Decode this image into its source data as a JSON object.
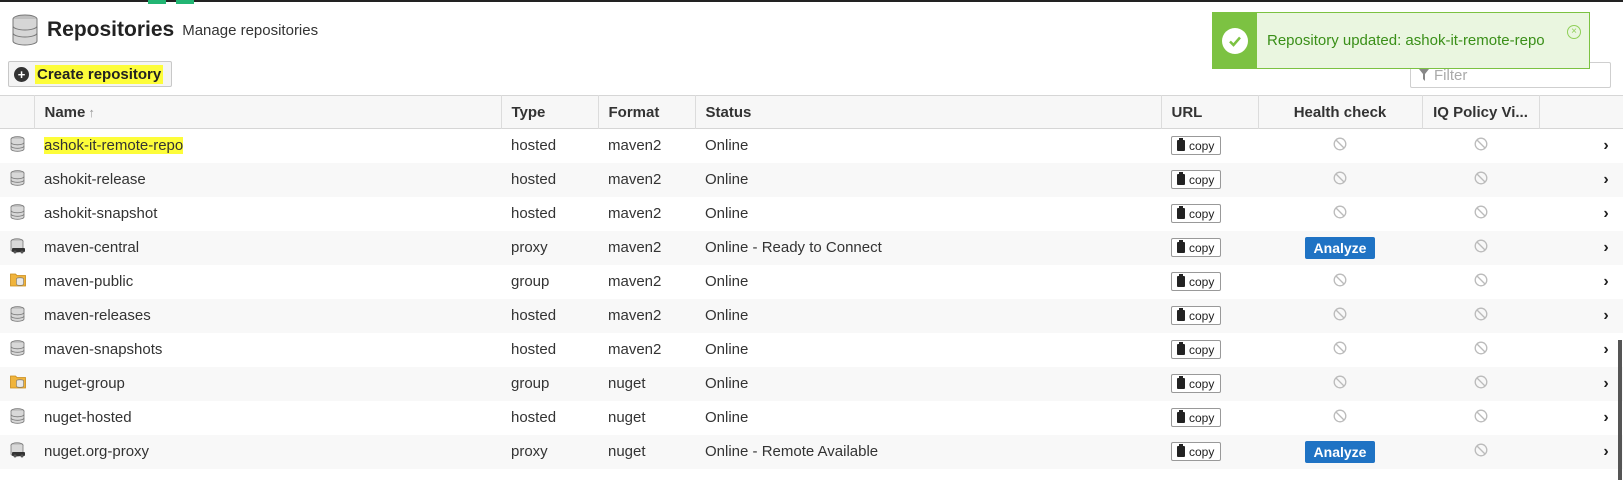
{
  "header": {
    "title": "Repositories",
    "subtitle": "Manage repositories"
  },
  "toolbar": {
    "create_label": "Create repository",
    "filter_placeholder": "Filter"
  },
  "toast": {
    "message": "Repository updated: ashok-it-remote-repo"
  },
  "table": {
    "columns": {
      "name": "Name",
      "sort_arrow": "↑",
      "type": "Type",
      "format": "Format",
      "status": "Status",
      "url": "URL",
      "health": "Health check",
      "iq": "IQ Policy Vi..."
    },
    "copy_label": "copy",
    "analyze_label": "Analyze",
    "rows": [
      {
        "icon": "hosted-repo-icon",
        "name": "ashok-it-remote-repo",
        "type": "hosted",
        "format": "maven2",
        "status": "Online",
        "health": "none",
        "highlight": true
      },
      {
        "icon": "hosted-repo-icon",
        "name": "ashokit-release",
        "type": "hosted",
        "format": "maven2",
        "status": "Online",
        "health": "none"
      },
      {
        "icon": "hosted-repo-icon",
        "name": "ashokit-snapshot",
        "type": "hosted",
        "format": "maven2",
        "status": "Online",
        "health": "none"
      },
      {
        "icon": "proxy-repo-icon",
        "name": "maven-central",
        "type": "proxy",
        "format": "maven2",
        "status": "Online - Ready to Connect",
        "health": "analyze"
      },
      {
        "icon": "group-repo-icon",
        "name": "maven-public",
        "type": "group",
        "format": "maven2",
        "status": "Online",
        "health": "none"
      },
      {
        "icon": "hosted-repo-icon",
        "name": "maven-releases",
        "type": "hosted",
        "format": "maven2",
        "status": "Online",
        "health": "none"
      },
      {
        "icon": "hosted-repo-icon",
        "name": "maven-snapshots",
        "type": "hosted",
        "format": "maven2",
        "status": "Online",
        "health": "none"
      },
      {
        "icon": "group-repo-icon",
        "name": "nuget-group",
        "type": "group",
        "format": "nuget",
        "status": "Online",
        "health": "none"
      },
      {
        "icon": "hosted-repo-icon",
        "name": "nuget-hosted",
        "type": "hosted",
        "format": "nuget",
        "status": "Online",
        "health": "none"
      },
      {
        "icon": "proxy-repo-icon",
        "name": "nuget.org-proxy",
        "type": "proxy",
        "format": "nuget",
        "status": "Online - Remote Available",
        "health": "analyze"
      }
    ]
  },
  "colors": {
    "accent_blue": "#1f73c4",
    "success_green": "#7cc242",
    "highlight_yellow": "#fdfd3a"
  }
}
